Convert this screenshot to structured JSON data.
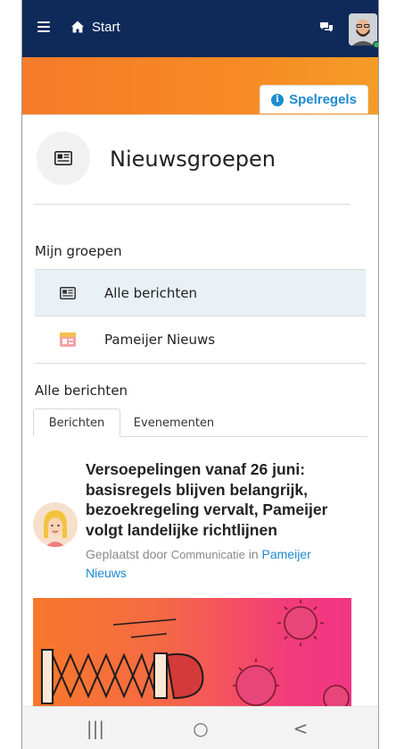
{
  "topbar": {
    "home_label": "Start",
    "bg_color": "#0f2a5a"
  },
  "header": {
    "rules_label": "Spelregels",
    "accent_color": "#1c8bd1"
  },
  "page": {
    "title": "Nieuwsgroepen",
    "title_icon": "newspaper-icon"
  },
  "groups": {
    "heading": "Mijn groepen",
    "items": [
      {
        "label": "Alle berichten",
        "icon": "newspaper-icon",
        "active": true
      },
      {
        "label": "Pameijer Nieuws",
        "icon": "group-thumbnail",
        "active": false
      }
    ]
  },
  "feed": {
    "heading": "Alle berichten",
    "tabs": [
      {
        "label": "Berichten",
        "active": true
      },
      {
        "label": "Evenementen",
        "active": false
      }
    ],
    "posts": [
      {
        "title": "Versoepelingen vanaf 26 juni: basisregels blijven belangrijk, bezoekregeling vervalt, Pameijer volgt landelijke richtlijnen",
        "meta_prefix": "Geplaatst door",
        "author": "Communicatie",
        "meta_in": "in",
        "group": "Pameijer Nieuws"
      }
    ]
  },
  "navbar": {
    "recent_glyph": "|||",
    "home_glyph": "○",
    "back_glyph": "<"
  }
}
